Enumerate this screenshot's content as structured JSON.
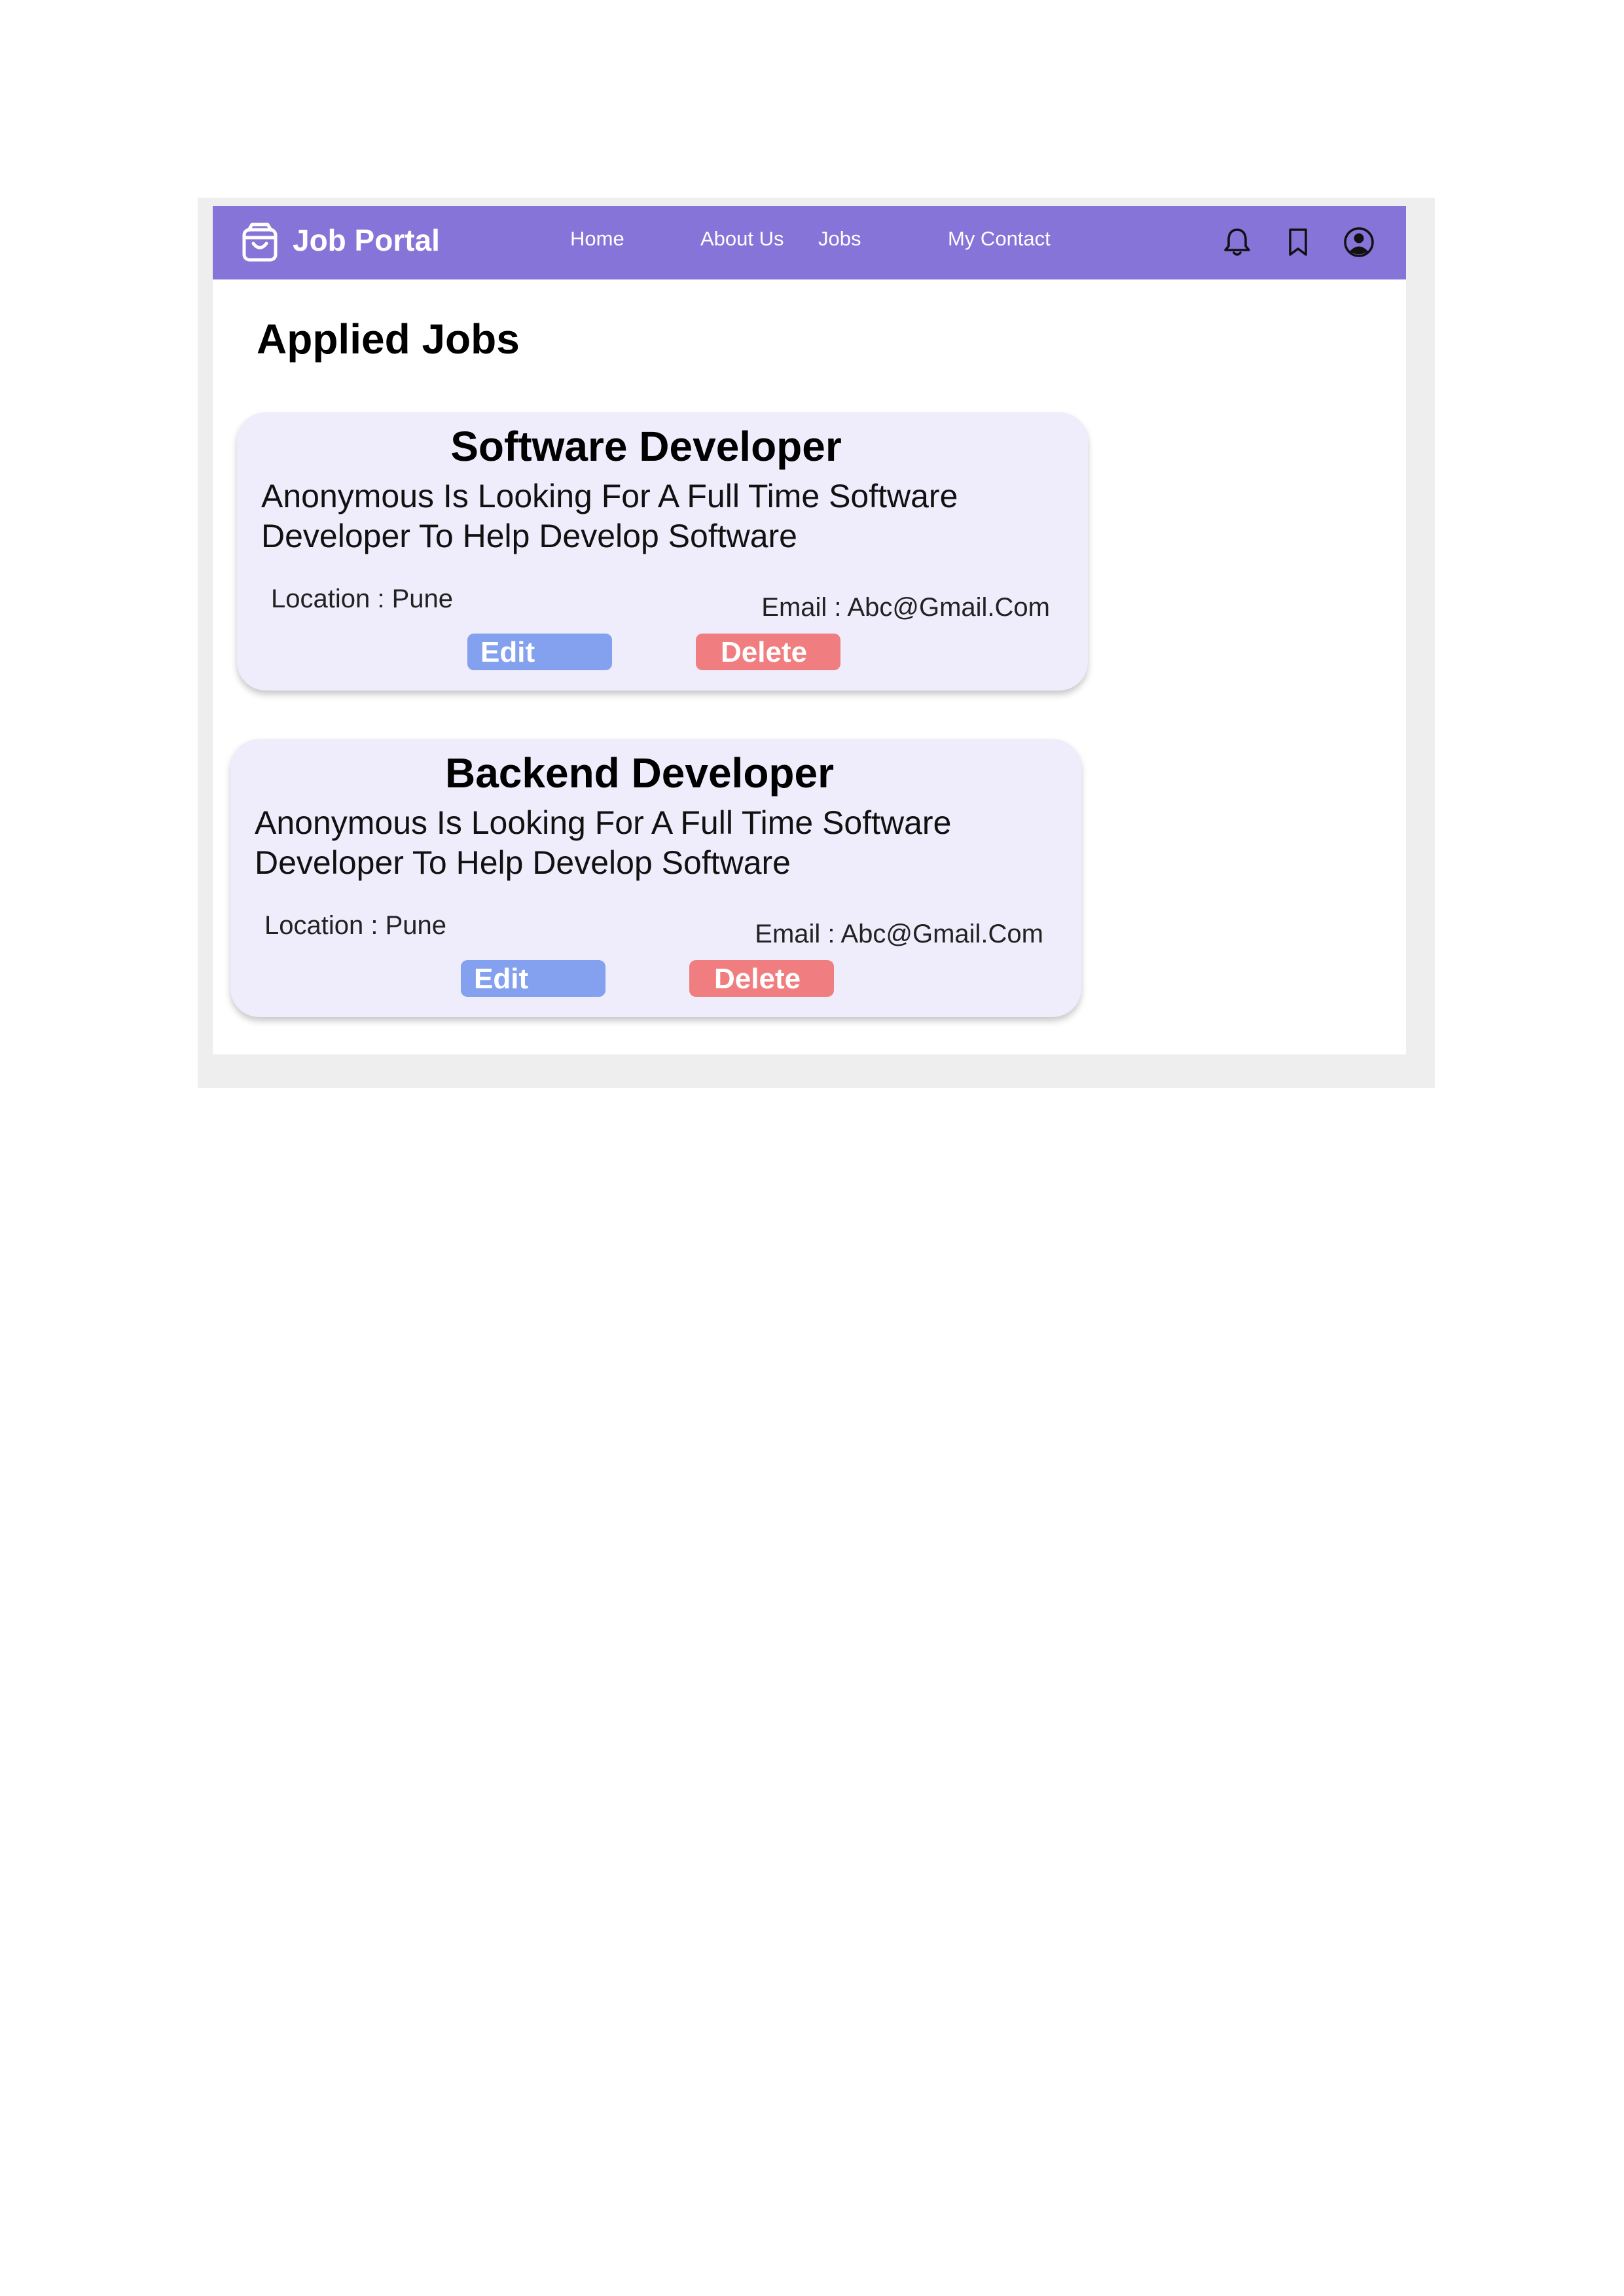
{
  "brand": {
    "name": "Job Portal"
  },
  "nav": {
    "links": [
      "Home",
      "About Us",
      "Jobs",
      "My Contact"
    ],
    "icons": [
      "bell-icon",
      "bookmark-icon",
      "user-account-icon"
    ]
  },
  "page": {
    "title": "Applied Jobs"
  },
  "jobs": [
    {
      "title": "Software Developer",
      "description": "Anonymous Is Looking For A Full Time Software Developer To Help Develop Software",
      "location": "Location : Pune",
      "email": "Email : Abc@Gmail.Com",
      "edit_label": "Edit",
      "delete_label": "Delete"
    },
    {
      "title": "Backend Developer",
      "description": "Anonymous Is Looking For A Full Time Software Developer To Help Develop Software",
      "location": "Location : Pune",
      "email": "Email : Abc@Gmail.Com",
      "edit_label": "Edit",
      "delete_label": "Delete"
    }
  ],
  "colors": {
    "navbar": "#8674d9",
    "card": "#efecfb",
    "edit_button": "#84a1ef",
    "delete_button": "#f07e80",
    "frame": "#eeeeee"
  }
}
